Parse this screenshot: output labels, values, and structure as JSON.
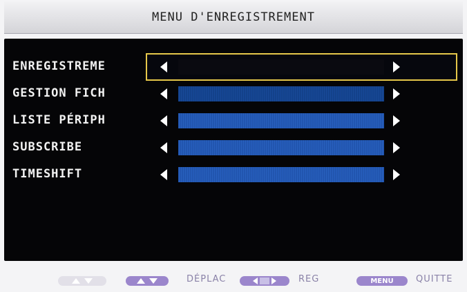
{
  "header": {
    "title": "MENU D'ENREGISTREMENT"
  },
  "menu": {
    "items": [
      {
        "label": "ENREGISTREME",
        "selected": true
      },
      {
        "label": "GESTION FICH",
        "selected": false
      },
      {
        "label": "LISTE PÉRIPH",
        "selected": false
      },
      {
        "label": "SUBSCRIBE",
        "selected": false
      },
      {
        "label": "TIMESHIFT",
        "selected": false
      }
    ]
  },
  "help": {
    "move_label": "DÉPLAC",
    "adjust_label": "REG",
    "menu_key": "MENU",
    "quit_label": "QUITTE"
  },
  "colors": {
    "selection_border": "#e6c84a",
    "bar_blue": "#2b66c6",
    "help_pill": "#9b86cc"
  }
}
